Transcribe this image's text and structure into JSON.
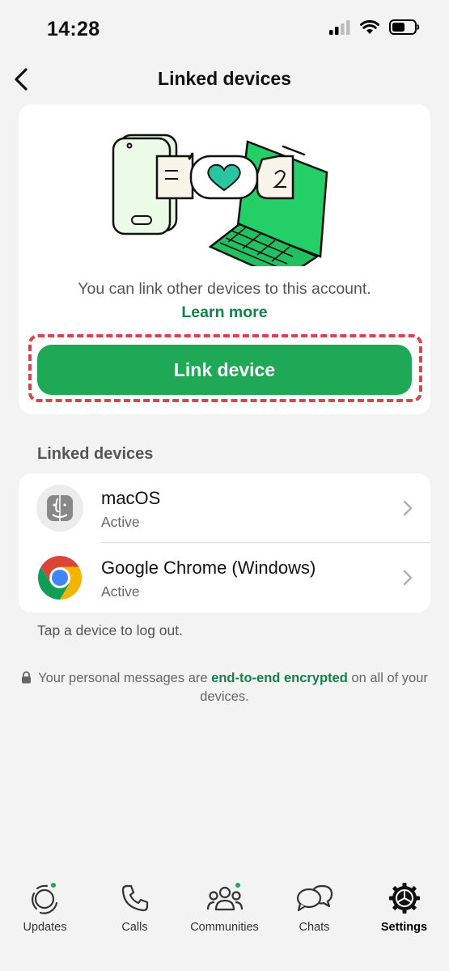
{
  "status_bar": {
    "time": "14:28"
  },
  "header": {
    "title": "Linked devices"
  },
  "hero": {
    "description": "You can link other devices to this account.",
    "learn_more": "Learn more",
    "link_button": "Link device"
  },
  "linked_section": {
    "title": "Linked devices",
    "devices": [
      {
        "name": "macOS",
        "status": "Active",
        "icon": "finder-icon"
      },
      {
        "name": "Google Chrome (Windows)",
        "status": "Active",
        "icon": "chrome-icon"
      }
    ],
    "tap_note": "Tap a device to log out."
  },
  "encryption_note": {
    "prefix": "Your personal messages are ",
    "link": "end-to-end encrypted",
    "suffix": " on all of your devices."
  },
  "tabs": [
    {
      "label": "Updates",
      "icon": "updates-icon",
      "badge": true
    },
    {
      "label": "Calls",
      "icon": "phone-icon",
      "badge": false
    },
    {
      "label": "Communities",
      "icon": "communities-icon",
      "badge": true
    },
    {
      "label": "Chats",
      "icon": "chats-icon",
      "badge": false
    },
    {
      "label": "Settings",
      "icon": "settings-icon",
      "badge": false,
      "active": true
    }
  ],
  "colors": {
    "accent": "#1fa855",
    "link": "#15804a",
    "highlight": "#d9454e"
  }
}
